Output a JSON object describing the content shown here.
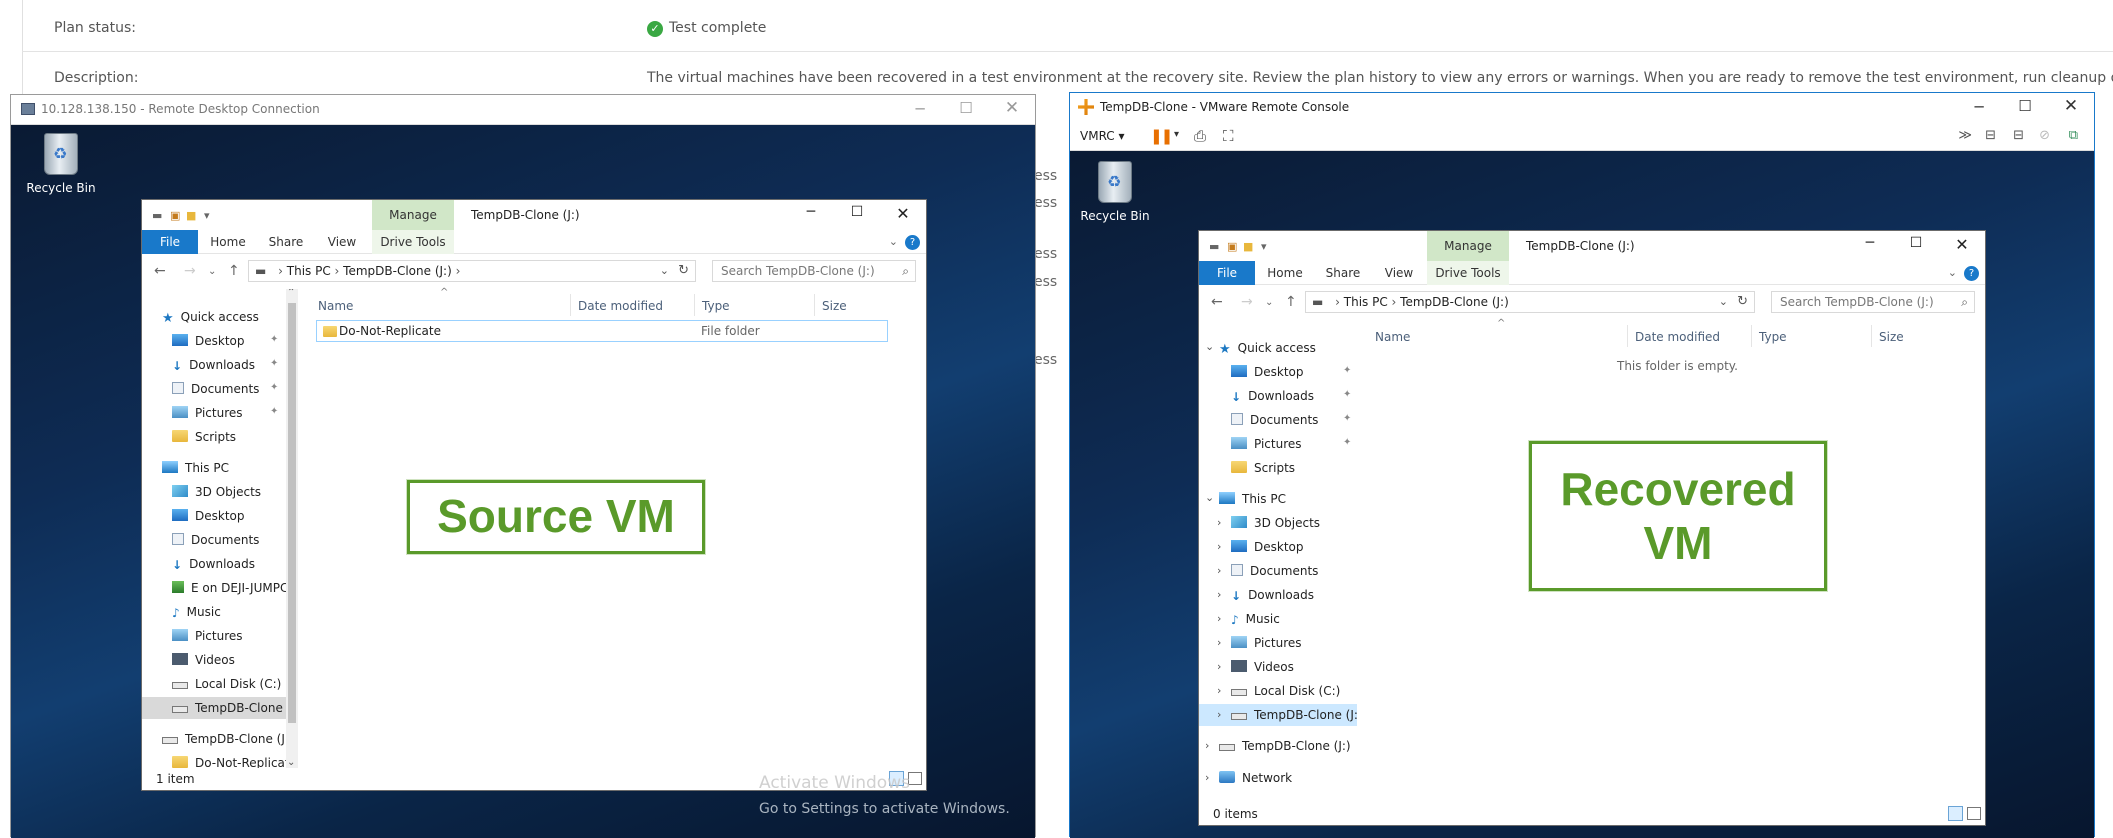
{
  "background": {
    "plan_status_label": "Plan status:",
    "plan_status_value": "Test complete",
    "description_label": "Description:",
    "description_value": "The virtual machines have been recovered in a test environment at the recovery site. Review the plan history to view any errors or warnings. When you are ready to remove the test environment, run cleanup on this plan.",
    "partial_text": "ess"
  },
  "rdp": {
    "title": "10.128.138.150 - Remote Desktop Connection",
    "recycle_bin": "Recycle Bin",
    "explorer": {
      "manage_tab": "Manage",
      "window_title": "TempDB-Clone (J:)",
      "ribbon_tabs": [
        "File",
        "Home",
        "Share",
        "View",
        "Drive Tools"
      ],
      "breadcrumb": [
        "This PC",
        "TempDB-Clone (J:)"
      ],
      "search_placeholder": "Search TempDB-Clone (J:)",
      "columns": [
        "Name",
        "Date modified",
        "Type",
        "Size"
      ],
      "nav_items": [
        "Quick access",
        "Desktop",
        "Downloads",
        "Documents",
        "Pictures",
        "Scripts",
        "This PC",
        "3D Objects",
        "Desktop",
        "Documents",
        "Downloads",
        "E on DEJI-JUMPC",
        "Music",
        "Pictures",
        "Videos",
        "Local Disk (C:)",
        "TempDB-Clone (",
        "TempDB-Clone (J:",
        "Do-Not-Replicat"
      ],
      "files": [
        {
          "name": "Do-Not-Replicate",
          "date": "",
          "type": "File folder",
          "size": ""
        }
      ],
      "status": "1 item"
    },
    "label": "Source VM",
    "activate_title": "Activate Windows",
    "activate_sub": "Go to Settings to activate Windows."
  },
  "vmrc": {
    "title": "TempDB-Clone - VMware Remote Console",
    "menu_label": "VMRC",
    "recycle_bin": "Recycle Bin",
    "explorer": {
      "manage_tab": "Manage",
      "window_title": "TempDB-Clone (J:)",
      "ribbon_tabs": [
        "File",
        "Home",
        "Share",
        "View",
        "Drive Tools"
      ],
      "breadcrumb": [
        "This PC",
        "TempDB-Clone (J:)"
      ],
      "search_placeholder": "Search TempDB-Clone (J:)",
      "columns": [
        "Name",
        "Date modified",
        "Type",
        "Size"
      ],
      "nav_items": [
        "Quick access",
        "Desktop",
        "Downloads",
        "Documents",
        "Pictures",
        "Scripts",
        "This PC",
        "3D Objects",
        "Desktop",
        "Documents",
        "Downloads",
        "Music",
        "Pictures",
        "Videos",
        "Local Disk (C:)",
        "TempDB-Clone (J:)",
        "TempDB-Clone (J:)",
        "Network"
      ],
      "empty_message": "This folder is empty.",
      "status": "0 items"
    },
    "label_line1": "Recovered",
    "label_line2": "VM"
  },
  "colors": {
    "accent": "#1979ca",
    "label_green": "#5a9a2a",
    "status_ok": "#3aa843"
  }
}
